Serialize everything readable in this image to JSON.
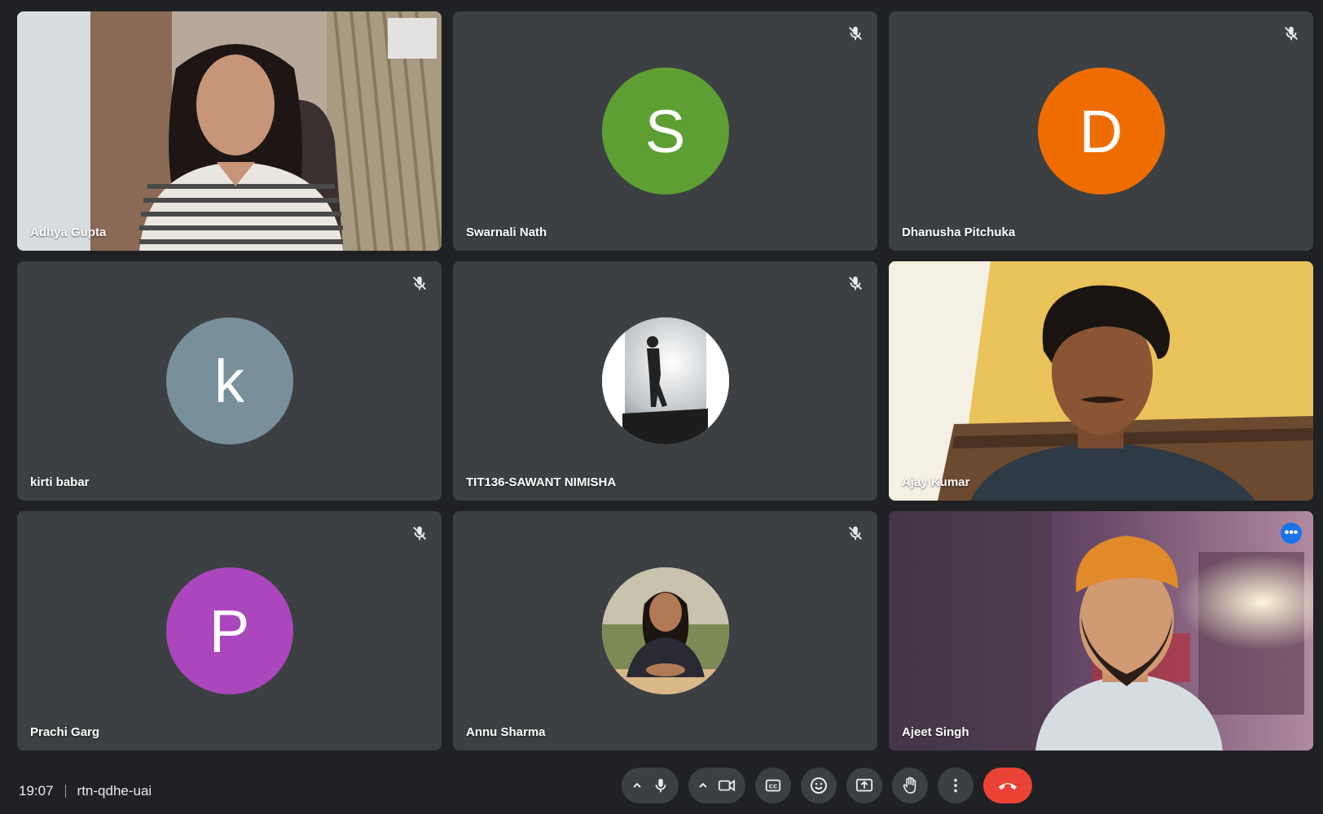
{
  "participants": [
    {
      "name": "Adhya Gupta",
      "type": "video"
    },
    {
      "name": "Swarnali Nath",
      "type": "initial",
      "initial": "S",
      "color": "#5e9f34",
      "muted": true
    },
    {
      "name": "Dhanusha Pitchuka",
      "type": "initial",
      "initial": "D",
      "color": "#ef6c00",
      "muted": true
    },
    {
      "name": "kirti babar",
      "type": "initial",
      "initial": "k",
      "color": "#78909c",
      "muted": true
    },
    {
      "name": "TIT136-SAWANT NIMISHA",
      "type": "photo",
      "muted": true
    },
    {
      "name": "Ajay Kumar",
      "type": "video"
    },
    {
      "name": "Prachi Garg",
      "type": "initial",
      "initial": "P",
      "color": "#ab47bc",
      "muted": true
    },
    {
      "name": "Annu Sharma",
      "type": "photo",
      "muted": true
    },
    {
      "name": "Ajeet Singh",
      "type": "video",
      "active": true
    }
  ],
  "bottom_bar": {
    "time": "19:07",
    "meeting_code": "rtn-qdhe-uai",
    "controls": [
      "microphone",
      "camera",
      "captions",
      "reactions",
      "present",
      "raise-hand",
      "more-options",
      "leave-call"
    ]
  },
  "colors": {
    "background": "#202124",
    "tile": "#3c4043",
    "end_call": "#ea4335",
    "active_border": "#8ab4f8"
  }
}
